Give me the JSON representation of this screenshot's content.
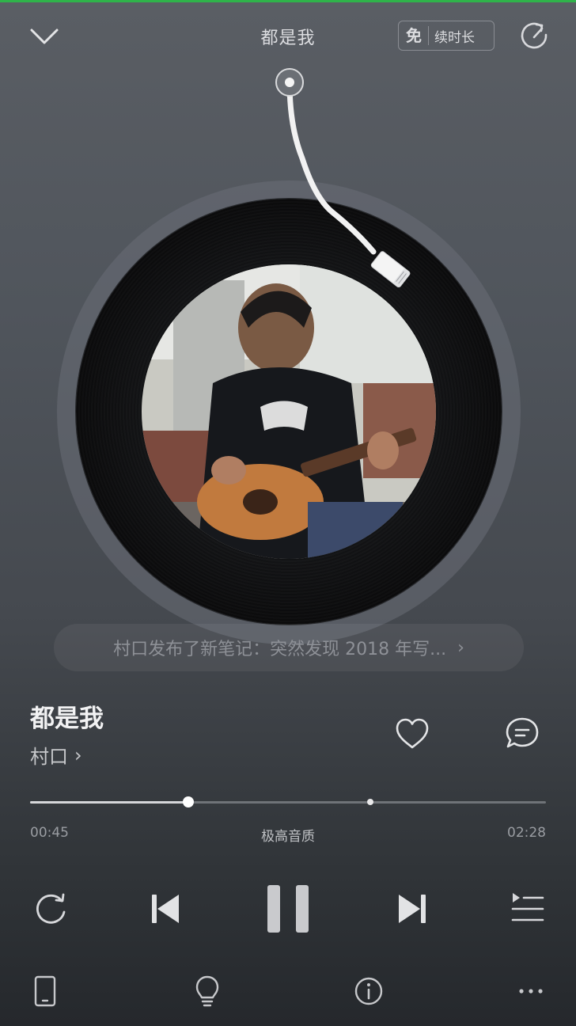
{
  "header": {
    "title": "都是我",
    "vip": {
      "free_label": "免",
      "extend_label": "续时长"
    }
  },
  "notification": {
    "text": "村口发布了新笔记：突然发现 2018 年写...",
    "arrow": "›"
  },
  "song": {
    "title": "都是我",
    "artist": "村口",
    "artist_chevron": "›"
  },
  "progress": {
    "current": "00:45",
    "total": "02:28",
    "quality": "极高音质",
    "played_fraction": 0.306,
    "buffered_fraction": 0.659
  },
  "icons": {
    "back": "chevron-down-icon",
    "share": "refresh-share-icon",
    "like": "heart-icon",
    "comment": "comment-icon",
    "repeat": "repeat-icon",
    "prev": "skip-previous-icon",
    "pause": "pause-icon",
    "next": "skip-next-icon",
    "playlist": "playlist-icon",
    "device": "phone-device-icon",
    "tips": "lightbulb-icon",
    "info": "info-icon",
    "more": "more-icon"
  },
  "colors": {
    "accent_top_line": "#2fb34a",
    "background_top": "#5a5e64",
    "background_bottom": "#25282c"
  }
}
